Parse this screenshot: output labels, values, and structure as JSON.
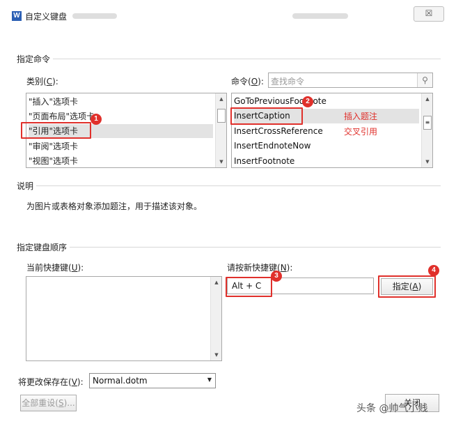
{
  "window": {
    "app_icon_letter": "W",
    "title": "自定义键盘",
    "close_glyph": "☒"
  },
  "specify_command": {
    "group_label": "指定命令",
    "category_label": "类别(C):",
    "category_label_prefix": "类别(",
    "category_label_key": "C",
    "category_label_suffix": "):",
    "categories": [
      "\"插入\"选项卡",
      "\"页面布局\"选项卡",
      "\"引用\"选项卡",
      "\"审阅\"选项卡",
      "\"视图\"选项卡"
    ],
    "selected_category_index": 2,
    "command_label_prefix": "命令(",
    "command_label_key": "O",
    "command_label_suffix": "):",
    "search_placeholder": "查找命令",
    "commands": [
      "GoToPreviousFootnote",
      "InsertCaption",
      "InsertCrossReference",
      "InsertEndnoteNow",
      "InsertFootnote"
    ],
    "selected_command_index": 1,
    "annotations": {
      "insert_caption": "插入题注",
      "cross_reference": "交叉引用"
    }
  },
  "description": {
    "group_label": "说明",
    "text": "为图片或表格对象添加题注，用于描述该对象。"
  },
  "keyboard_sequence": {
    "group_label": "指定键盘顺序",
    "current_label_prefix": "当前快捷键(",
    "current_label_key": "U",
    "current_label_suffix": "):",
    "new_label_prefix": "请按新快捷键(",
    "new_label_key": "N",
    "new_label_suffix": "):",
    "new_shortcut_value": "Alt + C",
    "assign_button_prefix": "指定(",
    "assign_button_key": "A",
    "assign_button_suffix": ")"
  },
  "save_in": {
    "label_prefix": "将更改保存在(",
    "label_key": "V",
    "label_suffix": "):",
    "selected": "Normal.dotm"
  },
  "footer": {
    "reset_all_prefix": "全部重设(",
    "reset_all_key": "S",
    "reset_all_suffix": ")...",
    "close_button": "关闭"
  },
  "steps": [
    "1",
    "2",
    "3",
    "4"
  ],
  "watermark": "头条 @帅气小贱",
  "colors": {
    "annotation_red": "#e0302b",
    "selection_gray": "#e3e3e3"
  }
}
